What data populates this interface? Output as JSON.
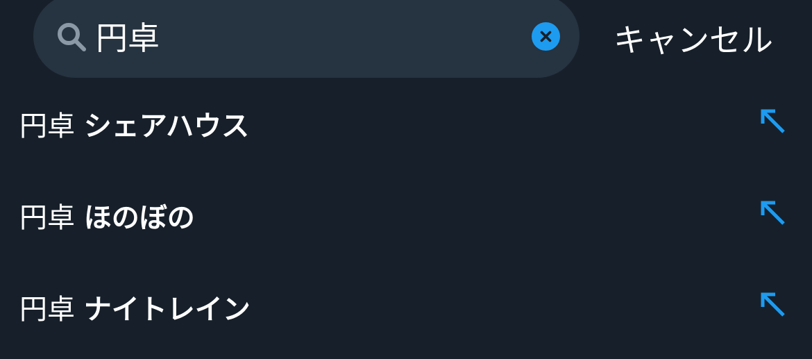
{
  "search": {
    "query": "円卓",
    "clear_icon": "clear-x-icon",
    "search_icon": "magnifier-icon"
  },
  "cancel_label": "キャンセル",
  "suggestions": [
    {
      "query": "円卓",
      "completion": "シェアハウス",
      "icon": "fill-arrow-up-left-icon"
    },
    {
      "query": "円卓",
      "completion": "ほのぼの",
      "icon": "fill-arrow-up-left-icon"
    },
    {
      "query": "円卓",
      "completion": "ナイトレイン",
      "icon": "fill-arrow-up-left-icon"
    }
  ],
  "colors": {
    "background": "#17202A",
    "search_field": "#263340",
    "accent": "#1D9BF0",
    "icon_gray": "#8B98A5",
    "text": "#FFFFFF"
  }
}
